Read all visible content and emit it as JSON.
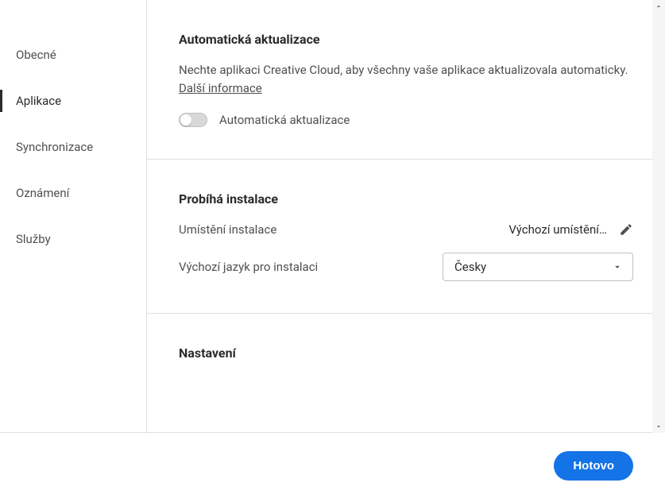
{
  "sidebar": {
    "items": [
      {
        "label": "Obecné"
      },
      {
        "label": "Aplikace"
      },
      {
        "label": "Synchronizace"
      },
      {
        "label": "Oznámení"
      },
      {
        "label": "Služby"
      }
    ],
    "activeIndex": 1
  },
  "sections": {
    "autoUpdate": {
      "title": "Automatická aktualizace",
      "description": "Nechte aplikaci Creative Cloud, aby všechny vaše aplikace aktualizovala automaticky. ",
      "moreInfo": "Další informace",
      "toggleLabel": "Automatická aktualizace",
      "toggleOn": false
    },
    "install": {
      "title": "Probíhá instalace",
      "locationLabel": "Umístění instalace",
      "locationValue": "Výchozí umístění…",
      "languageLabel": "Výchozí jazyk pro instalaci",
      "languageValue": "Česky"
    },
    "settings": {
      "title": "Nastavení"
    }
  },
  "footer": {
    "doneLabel": "Hotovo"
  }
}
